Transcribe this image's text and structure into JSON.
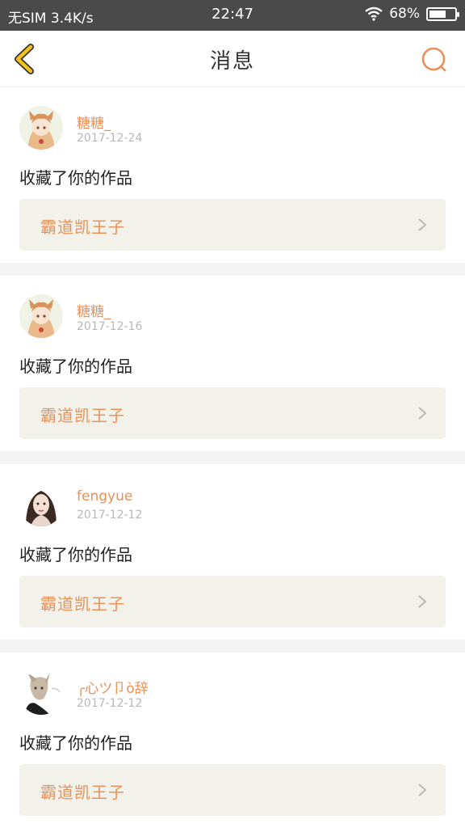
{
  "status_bar": {
    "carrier": "无SIM 3.4K/s",
    "time": "22:47",
    "battery": "68%",
    "battery_level": 0.68
  },
  "nav": {
    "title": "消息",
    "back_icon": "chevron-left-icon",
    "search_icon": "search-icon"
  },
  "colors": {
    "accent": "#e8915a",
    "back_icon": "#f2c21b",
    "card_bg": "#f3f2ea"
  },
  "messages": [
    {
      "user": "糖糖_",
      "date": "2017-12-24",
      "action": "收藏了你的作品",
      "work": "霸道凯王子"
    },
    {
      "user": "糖糖_",
      "date": "2017-12-16",
      "action": "收藏了你的作品",
      "work": "霸道凯王子"
    },
    {
      "user": "fengyue",
      "date": "2017-12-12",
      "action": "收藏了你的作品",
      "work": "霸道凯王子"
    },
    {
      "user": "╭心ツ卩ò辞",
      "date": "2017-12-12",
      "action": "收藏了你的作品",
      "work": "霸道凯王子"
    }
  ]
}
